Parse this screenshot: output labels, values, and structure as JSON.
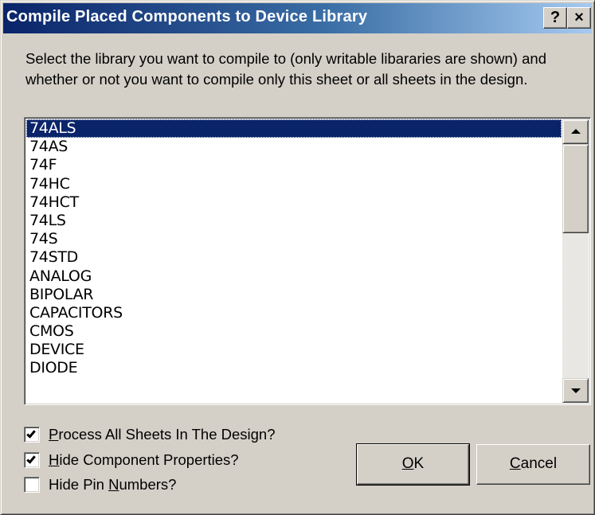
{
  "window": {
    "title": "Compile Placed Components to Device Library",
    "help_label": "?",
    "close_label": "×"
  },
  "instructions": "Select the library you want to compile to (only writable libararies are shown) and whether or not you want to compile only this sheet or all sheets in the design.",
  "library_list": {
    "selected": "74ALS",
    "items": [
      "74ALS",
      "74AS",
      "74F",
      "74HC",
      "74HCT",
      "74LS",
      "74S",
      "74STD",
      "ANALOG",
      "BIPOLAR",
      "CAPACITORS",
      "CMOS",
      "DEVICE",
      "DIODE"
    ]
  },
  "options": {
    "process_all": {
      "pre": "",
      "u": "P",
      "post": "rocess All Sheets In The Design?",
      "checked": true
    },
    "hide_props": {
      "pre": "",
      "u": "H",
      "post": "ide Component Properties?",
      "checked": true
    },
    "hide_pins": {
      "pre": "Hide Pin ",
      "u": "N",
      "post": "umbers?",
      "checked": false
    }
  },
  "buttons": {
    "ok": {
      "u": "O",
      "post": "K"
    },
    "cancel": {
      "u": "C",
      "post": "ancel"
    }
  },
  "colors": {
    "title_start": "#0a246a",
    "selection": "#0a246a",
    "face": "#d4d0c8"
  },
  "icons": {
    "check": "check-icon",
    "scroll_up": "triangle-up-icon",
    "scroll_down": "triangle-down-icon"
  }
}
